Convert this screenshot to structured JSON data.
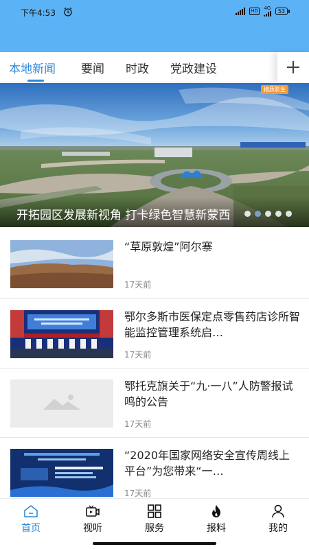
{
  "status_bar": {
    "time": "下午4:53",
    "hd": "HD",
    "network": "4G",
    "battery": "53"
  },
  "tabs": [
    {
      "label": "本地新闻",
      "active": true
    },
    {
      "label": "要闻",
      "active": false
    },
    {
      "label": "时政",
      "active": false
    },
    {
      "label": "党政建设",
      "active": false
    }
  ],
  "banner": {
    "badge": "摘质影生",
    "caption": "开拓园区发展新视角  打卡绿色智慧新蒙西",
    "slide_count": 5,
    "active_slide": 1
  },
  "news": [
    {
      "title": "“草原敦煌”阿尔寨",
      "time": "17天前",
      "thumb": "landscape"
    },
    {
      "title": "鄂尔多斯市医保定点零售药店诊所智能监控管理系统启…",
      "time": "17天前",
      "thumb": "conference"
    },
    {
      "title": "鄂托克旗关于“九·一八”人防警报试鸣的公告",
      "time": "17天前",
      "thumb": "placeholder"
    },
    {
      "title": "“2020年国家网络安全宣传周线上平台”为您带来“一…",
      "time": "17天前",
      "thumb": "poster"
    }
  ],
  "bottom_nav": [
    {
      "label": "首页",
      "icon": "home-icon",
      "active": true
    },
    {
      "label": "视听",
      "icon": "video-icon",
      "active": false
    },
    {
      "label": "服务",
      "icon": "grid-icon",
      "active": false
    },
    {
      "label": "报料",
      "icon": "fire-icon",
      "active": false
    },
    {
      "label": "我的",
      "icon": "user-icon",
      "active": false
    }
  ],
  "colors": {
    "header": "#5bb2f5",
    "accent": "#2e88d8"
  }
}
